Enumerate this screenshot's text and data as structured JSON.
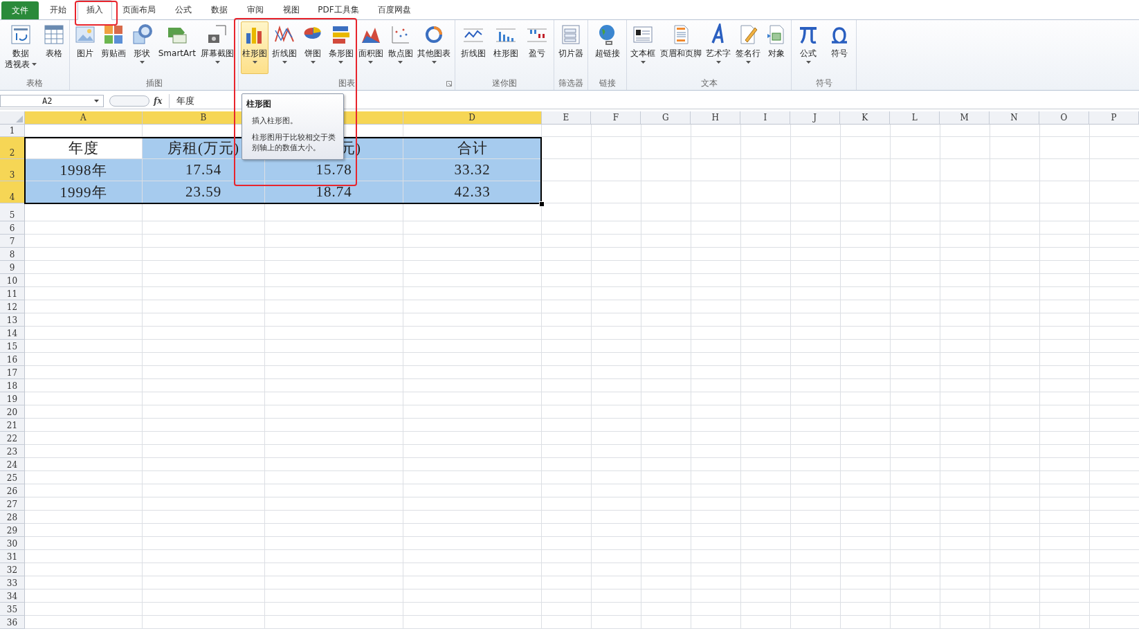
{
  "tabs": [
    {
      "label": "文件",
      "kind": "file",
      "selected": false
    },
    {
      "label": "开始",
      "kind": "tab",
      "selected": false
    },
    {
      "label": "插入",
      "kind": "tab",
      "selected": true
    },
    {
      "label": "页面布局",
      "kind": "tab",
      "selected": false
    },
    {
      "label": "公式",
      "kind": "tab",
      "selected": false
    },
    {
      "label": "数据",
      "kind": "tab",
      "selected": false
    },
    {
      "label": "审阅",
      "kind": "tab",
      "selected": false
    },
    {
      "label": "视图",
      "kind": "tab",
      "selected": false
    },
    {
      "label": "PDF工具集",
      "kind": "tab",
      "selected": false
    },
    {
      "label": "百度网盘",
      "kind": "tab",
      "selected": false
    }
  ],
  "ribbon_groups": [
    {
      "label": "表格",
      "launcher": false,
      "buttons": [
        {
          "lines": [
            "数据",
            "透视表"
          ],
          "dropdown": true,
          "selected": false
        },
        {
          "label": "表格",
          "dropdown": false,
          "selected": false
        }
      ]
    },
    {
      "label": "插图",
      "launcher": false,
      "buttons": [
        {
          "label": "图片",
          "dropdown": false,
          "selected": false
        },
        {
          "label": "剪贴画",
          "dropdown": false,
          "selected": false
        },
        {
          "label": "形状",
          "dropdown": true,
          "selected": false
        },
        {
          "label": "SmartArt",
          "dropdown": false,
          "selected": false
        },
        {
          "label": "屏幕截图",
          "dropdown": true,
          "selected": false
        }
      ]
    },
    {
      "label": "图表",
      "launcher": true,
      "buttons": [
        {
          "label": "柱形图",
          "dropdown": true,
          "selected": true
        },
        {
          "label": "折线图",
          "dropdown": true,
          "selected": false
        },
        {
          "label": "饼图",
          "dropdown": true,
          "selected": false
        },
        {
          "label": "条形图",
          "dropdown": true,
          "selected": false
        },
        {
          "label": "面积图",
          "dropdown": true,
          "selected": false
        },
        {
          "label": "散点图",
          "dropdown": true,
          "selected": false
        },
        {
          "label": "其他图表",
          "dropdown": true,
          "selected": false
        }
      ]
    },
    {
      "label": "迷你图",
      "launcher": false,
      "buttons": [
        {
          "label": "折线图",
          "dropdown": false,
          "selected": false
        },
        {
          "label": "柱形图",
          "dropdown": false,
          "selected": false
        },
        {
          "label": "盈亏",
          "dropdown": false,
          "selected": false
        }
      ]
    },
    {
      "label": "筛选器",
      "launcher": false,
      "buttons": [
        {
          "label": "切片器",
          "dropdown": false,
          "selected": false
        }
      ]
    },
    {
      "label": "链接",
      "launcher": false,
      "buttons": [
        {
          "label": "超链接",
          "dropdown": false,
          "selected": false
        }
      ]
    },
    {
      "label": "文本",
      "launcher": false,
      "buttons": [
        {
          "label": "文本框",
          "dropdown": true,
          "selected": false
        },
        {
          "label": "页眉和页脚",
          "dropdown": false,
          "selected": false
        },
        {
          "label": "艺术字",
          "dropdown": true,
          "selected": false
        },
        {
          "label": "签名行",
          "dropdown": true,
          "selected": false
        },
        {
          "label": "对象",
          "dropdown": false,
          "selected": false
        }
      ]
    },
    {
      "label": "符号",
      "launcher": false,
      "buttons": [
        {
          "label": "公式",
          "dropdown": true,
          "selected": false
        },
        {
          "label": "符号",
          "dropdown": false,
          "selected": false
        }
      ]
    }
  ],
  "formula_bar": {
    "name_box": "A2",
    "function_label": "fx",
    "value": "年度"
  },
  "tooltip": {
    "title": "柱形图",
    "lines": [
      "插入柱形图。",
      "柱形图用于比较相交于类别轴上的数值大小。"
    ]
  },
  "columns": [
    {
      "label": "A",
      "selected": true
    },
    {
      "label": "B",
      "selected": true
    },
    {
      "selected": true
    },
    {
      "label": "D",
      "selected": true
    },
    {
      "label": "E",
      "selected": false
    },
    {
      "label": "F",
      "selected": false
    },
    {
      "label": "G",
      "selected": false
    },
    {
      "label": "H",
      "selected": false
    },
    {
      "label": "I",
      "selected": false
    },
    {
      "label": "J",
      "selected": false
    },
    {
      "label": "K",
      "selected": false
    },
    {
      "label": "L",
      "selected": false
    },
    {
      "label": "M",
      "selected": false
    },
    {
      "label": "N",
      "selected": false
    },
    {
      "label": "O",
      "selected": false
    },
    {
      "label": "P",
      "selected": false
    }
  ],
  "rows": [
    {
      "label": "1",
      "selected": false,
      "cells": []
    },
    {
      "label": "2",
      "selected": true,
      "cells": [
        {
          "text": "年度",
          "selected": true,
          "active": true
        },
        {
          "text": "房租(万元)",
          "selected": true,
          "active": false
        },
        {
          "text": "元)",
          "selected": true,
          "active": false
        },
        {
          "text": "合计",
          "selected": true,
          "active": false
        }
      ]
    },
    {
      "label": "3",
      "selected": true,
      "cells": [
        {
          "text": "1998年",
          "selected": true,
          "active": false
        },
        {
          "text": "17.54",
          "selected": true,
          "active": false
        },
        {
          "text": "15.78",
          "selected": true,
          "active": false
        },
        {
          "text": "33.32",
          "selected": true,
          "active": false
        }
      ]
    },
    {
      "label": "4",
      "selected": true,
      "cells": [
        {
          "text": "1999年",
          "selected": true,
          "active": false
        },
        {
          "text": "23.59",
          "selected": true,
          "active": false
        },
        {
          "text": "18.74",
          "selected": true,
          "active": false
        },
        {
          "text": "42.33",
          "selected": true,
          "active": false
        }
      ]
    },
    {
      "label": "5",
      "selected": false,
      "cells": []
    },
    {
      "label": "6",
      "selected": false,
      "cells": []
    },
    {
      "label": "7",
      "selected": false,
      "cells": []
    },
    {
      "label": "8",
      "selected": false,
      "cells": []
    },
    {
      "label": "9",
      "selected": false,
      "cells": []
    },
    {
      "label": "10",
      "selected": false,
      "cells": []
    },
    {
      "label": "11",
      "selected": false,
      "cells": []
    },
    {
      "label": "12",
      "selected": false,
      "cells": []
    },
    {
      "label": "13",
      "selected": false,
      "cells": []
    },
    {
      "label": "14",
      "selected": false,
      "cells": []
    },
    {
      "label": "15",
      "selected": false,
      "cells": []
    },
    {
      "label": "16",
      "selected": false,
      "cells": []
    },
    {
      "label": "17",
      "selected": false,
      "cells": []
    },
    {
      "label": "18",
      "selected": false,
      "cells": []
    },
    {
      "label": "19",
      "selected": false,
      "cells": []
    },
    {
      "label": "20",
      "selected": false,
      "cells": []
    },
    {
      "label": "21",
      "selected": false,
      "cells": []
    },
    {
      "label": "22",
      "selected": false,
      "cells": []
    },
    {
      "label": "23",
      "selected": false,
      "cells": []
    },
    {
      "label": "24",
      "selected": false,
      "cells": []
    },
    {
      "label": "25",
      "selected": false,
      "cells": []
    },
    {
      "label": "26",
      "selected": false,
      "cells": []
    },
    {
      "label": "27",
      "selected": false,
      "cells": []
    },
    {
      "label": "28",
      "selected": false,
      "cells": []
    },
    {
      "label": "29",
      "selected": false,
      "cells": []
    },
    {
      "label": "30",
      "selected": false,
      "cells": []
    },
    {
      "label": "31",
      "selected": false,
      "cells": []
    },
    {
      "label": "32",
      "selected": false,
      "cells": []
    },
    {
      "label": "33",
      "selected": false,
      "cells": []
    },
    {
      "label": "34",
      "selected": false,
      "cells": []
    },
    {
      "label": "35",
      "selected": false,
      "cells": []
    },
    {
      "label": "36",
      "selected": false,
      "cells": []
    }
  ]
}
